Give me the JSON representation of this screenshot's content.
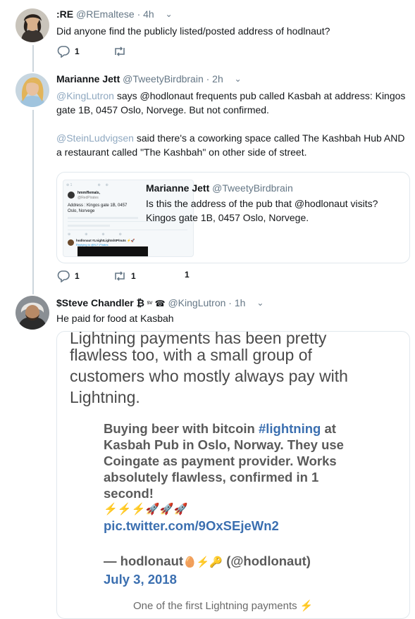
{
  "tweets": [
    {
      "name": ":RE",
      "handle": "@REmaltese",
      "time": "· 4h",
      "text": "Did anyone find the publicly listed/posted address of hodlnaut?",
      "reply_count": "1",
      "retweet_count": "",
      "like_count": ""
    },
    {
      "name": "Marianne Jett",
      "handle": "@TweetyBirdbrain",
      "time": "· 2h",
      "p1_mention": "@KingLutron",
      "p1_rest_a": " says @hodlonaut frequents pub called Kasbah at address: Kingos",
      "p1_rest_b": "gate 1B, 0457 Oslo, Norvege. But not confirmed.",
      "p2_mention": "@SteinLudvigsen",
      "p2_rest_a": " said there's a coworking space called The Kashbah Hub AND",
      "p2_rest_b": "a restaurant called \"The Kashbah\" on other side of street.",
      "quote": {
        "name": "Marianne Jett",
        "handle": "@TweetyBirdbrain",
        "line1": "Is this the address of the pub that @hodlonaut visits?",
        "line2": "Kingos gate 1B, 0457 Oslo, Norvege.",
        "thumb_name": "hmm/flemals,",
        "thumb_handle": "@RedPirates",
        "thumb_text": "Address : Kingos gate 1B, 0457 Oslo, Norvege",
        "thumb_reply": "hodlonaut #LnightLightshtP/nuts ⚡🚀",
        "thumb_reply2": "Replying to @N-F-Pirates"
      },
      "reply_count": "1",
      "retweet_count": "1",
      "like_count": "1"
    },
    {
      "name": "$Steve Chandler ₿",
      "name_suffix": " ˢᵛ ☎",
      "handle": "@KingLutron",
      "time": "· 1h",
      "text": "He paid for food at Kasbah",
      "media": {
        "cut_line": "Lightning payments has been pretty",
        "intro_lines": [
          "flawless too, with a small group of",
          "customers who mostly always pay with",
          "Lightning."
        ],
        "embed_a": "Buying beer with bitcoin ",
        "embed_hashtag": "#lightning",
        "embed_b": " at",
        "embed_lines": [
          "Kasbah Pub in Oslo, Norway. They use",
          "Coingate as payment provider. Works",
          "absolutely flawless, confirmed in 1",
          "second!"
        ],
        "embed_emoji": "⚡⚡⚡🚀🚀🚀",
        "embed_link": "pic.twitter.com/9OxSEjeWn2",
        "author_a": "— hodlonaut",
        "author_emoji": "🥚⚡🔑",
        "author_b": " (@hodlonaut)",
        "date": "July 3, 2018",
        "footer": "One of the first Lightning payments ⚡"
      }
    }
  ],
  "colors": {
    "link": "#1b95e0",
    "muted": "#657786",
    "text": "#14171a"
  }
}
